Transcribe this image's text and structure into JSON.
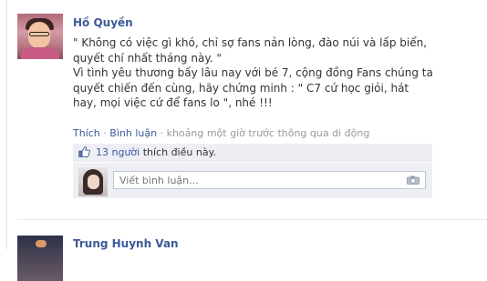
{
  "posts": [
    {
      "author": "Hồ Quyền",
      "message_lines": [
        "\" Không có việc gì khó, chỉ sợ fans nản lòng, đào núi và lấp biển, quyết chí nhất tháng này. \"",
        "Vì tình yêu thương bấy lâu nay với bé 7, cộng đồng Fans chúng ta quyết chiến đến cùng, hãy chứng minh : \" C7 cứ học giỏi, hát hay, mọi việc cứ để fans lo \", nhé !!!"
      ],
      "actions": {
        "like": "Thích",
        "comment": "Bình luận",
        "separator": "·",
        "time_text": "khoảng một giờ trước thông qua di động"
      },
      "likes": {
        "count_text": "13 người",
        "suffix": "thích điều này."
      },
      "comment_input": {
        "placeholder": "Viết bình luận..."
      }
    },
    {
      "author": "Trung Huynh Van"
    }
  ],
  "icons": {
    "like": "thumbs-up-icon",
    "photo": "camera-icon"
  },
  "colors": {
    "link": "#3b5998",
    "box_bg": "#edeff4",
    "text": "#333333",
    "muted": "#999999"
  }
}
